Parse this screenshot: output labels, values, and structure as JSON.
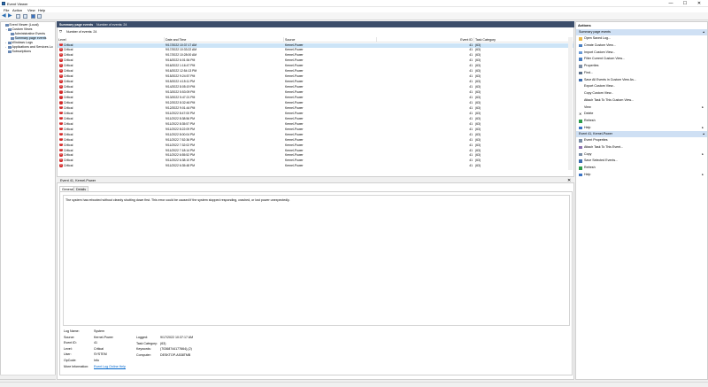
{
  "window": {
    "title": "Event Viewer"
  },
  "window_controls": {
    "minimize": "—",
    "maximize": "☐",
    "close": "✕"
  },
  "menu": [
    "File",
    "Action",
    "View",
    "Help"
  ],
  "tree": [
    {
      "label": "Event Viewer (Local)",
      "level": 0,
      "toggle": ""
    },
    {
      "label": "Custom Views",
      "level": 1,
      "toggle": "⌄"
    },
    {
      "label": "Administrative Events",
      "level": 2,
      "toggle": ""
    },
    {
      "label": "Summary page events",
      "level": 2,
      "toggle": "",
      "selected": true
    },
    {
      "label": "Windows Logs",
      "level": 1,
      "toggle": "›"
    },
    {
      "label": "Applications and Services Lo",
      "level": 1,
      "toggle": "›"
    },
    {
      "label": "Subscriptions",
      "level": 1,
      "toggle": ""
    }
  ],
  "center": {
    "title": "Summary page events",
    "count_label": "Number of events: 24",
    "filter_count": "Number of events: 24"
  },
  "grid": {
    "columns": [
      "Level",
      "Date and Time",
      "Source",
      "Event ID",
      "Task Category"
    ],
    "rows": [
      [
        "Critical",
        "9/17/2022 10:37:17 AM",
        "Kernel-Power",
        "41",
        "(63)"
      ],
      [
        "Critical",
        "9/17/2022 10:33:22 AM",
        "Kernel-Power",
        "41",
        "(63)"
      ],
      [
        "Critical",
        "9/17/2022 10:28:00 AM",
        "Kernel-Power",
        "41",
        "(63)"
      ],
      [
        "Critical",
        "9/16/2022 6:01:54 PM",
        "Kernel-Power",
        "41",
        "(63)"
      ],
      [
        "Critical",
        "9/16/2022 1:16:47 PM",
        "Kernel-Power",
        "41",
        "(63)"
      ],
      [
        "Critical",
        "9/16/2022 12:54:13 PM",
        "Kernel-Power",
        "41",
        "(63)"
      ],
      [
        "Critical",
        "9/15/2022 9:24:57 PM",
        "Kernel-Power",
        "41",
        "(63)"
      ],
      [
        "Critical",
        "9/15/2022 4:15:11 PM",
        "Kernel-Power",
        "41",
        "(63)"
      ],
      [
        "Critical",
        "9/14/2022 8:05:19 PM",
        "Kernel-Power",
        "41",
        "(63)"
      ],
      [
        "Critical",
        "9/13/2022 5:53:09 PM",
        "Kernel-Power",
        "41",
        "(63)"
      ],
      [
        "Critical",
        "9/13/2022 5:47:21 PM",
        "Kernel-Power",
        "41",
        "(63)"
      ],
      [
        "Critical",
        "9/12/2022 8:32:46 PM",
        "Kernel-Power",
        "41",
        "(63)"
      ],
      [
        "Critical",
        "9/12/2022 9:01:44 PM",
        "Kernel-Power",
        "41",
        "(63)"
      ],
      [
        "Critical",
        "9/11/2022 8:47:00 PM",
        "Kernel-Power",
        "41",
        "(63)"
      ],
      [
        "Critical",
        "9/11/2022 8:38:56 PM",
        "Kernel-Power",
        "41",
        "(63)"
      ],
      [
        "Critical",
        "9/11/2022 8:35:57 PM",
        "Kernel-Power",
        "41",
        "(63)"
      ],
      [
        "Critical",
        "9/11/2022 8:22:09 PM",
        "Kernel-Power",
        "41",
        "(63)"
      ],
      [
        "Critical",
        "9/11/2022 8:00:04 PM",
        "Kernel-Power",
        "41",
        "(63)"
      ],
      [
        "Critical",
        "9/11/2022 7:52:36 PM",
        "Kernel-Power",
        "41",
        "(63)"
      ],
      [
        "Critical",
        "9/11/2022 7:32:02 PM",
        "Kernel-Power",
        "41",
        "(63)"
      ],
      [
        "Critical",
        "9/11/2022 7:18:14 PM",
        "Kernel-Power",
        "41",
        "(63)"
      ],
      [
        "Critical",
        "9/11/2022 6:55:52 PM",
        "Kernel-Power",
        "41",
        "(63)"
      ],
      [
        "Critical",
        "9/11/2022 6:38:10 PM",
        "Kernel-Power",
        "41",
        "(63)"
      ],
      [
        "Critical",
        "9/11/2022 6:35:48 PM",
        "Kernel-Power",
        "41",
        "(63)"
      ]
    ]
  },
  "detail": {
    "title": "Event 41, Kernel-Power",
    "tabs": [
      "General",
      "Details"
    ],
    "description": "The system has rebooted without cleanly shutting down first. This error could be caused if the system stopped responding, crashed, or lost power unexpectedly.",
    "props_left": [
      [
        "Log Name:",
        "System"
      ],
      [
        "Source:",
        "Kernel-Power"
      ],
      [
        "Event ID:",
        "41"
      ],
      [
        "Level:",
        "Critical"
      ],
      [
        "User:",
        "SYSTEM"
      ],
      [
        "OpCode:",
        "Info"
      ],
      [
        "More Information:",
        "Event Log Online Help"
      ]
    ],
    "props_right": [
      [
        "Logged:",
        "9/17/2022 10:37:17 AM"
      ],
      [
        "Task Category:",
        "(63)"
      ],
      [
        "Keywords:",
        "(70368744177664),(2)"
      ],
      [
        "Computer:",
        "DESKTOP-A538TMB"
      ]
    ]
  },
  "actions": {
    "title": "Actions",
    "section1": "Summary page events",
    "items1": [
      {
        "label": "Open Saved Log...",
        "icon": "folder-icon",
        "sub": ""
      },
      {
        "label": "Create Custom View...",
        "icon": "filter-icon",
        "sub": ""
      },
      {
        "label": "Import Custom View...",
        "icon": "import-icon",
        "sub": ""
      },
      {
        "label": "Filter Current Custom View...",
        "icon": "filter-icon",
        "sub": ""
      },
      {
        "label": "Properties",
        "icon": "properties-icon",
        "sub": ""
      },
      {
        "label": "Find...",
        "icon": "find-icon",
        "sub": ""
      },
      {
        "label": "Save All Events in Custom View As...",
        "icon": "save-icon",
        "sub": ""
      },
      {
        "label": "Export Custom View...",
        "icon": "blank-icon",
        "sub": ""
      },
      {
        "label": "Copy Custom View...",
        "icon": "blank-icon",
        "sub": ""
      },
      {
        "label": "Attach Task To This Custom View...",
        "icon": "blank-icon",
        "sub": ""
      },
      {
        "label": "View",
        "icon": "blank-icon",
        "sub": "▸"
      },
      {
        "label": "Delete",
        "icon": "delete-icon",
        "sub": ""
      },
      {
        "label": "Refresh",
        "icon": "refresh-icon",
        "sub": ""
      },
      {
        "label": "Help",
        "icon": "help-icon",
        "sub": "▸"
      }
    ],
    "section2": "Event 41, Kernel-Power",
    "items2": [
      {
        "label": "Event Properties",
        "icon": "properties-icon",
        "sub": ""
      },
      {
        "label": "Attach Task To This Event...",
        "icon": "task-icon",
        "sub": ""
      },
      {
        "label": "Copy",
        "icon": "copy-icon",
        "sub": "▸"
      },
      {
        "label": "Save Selected Events...",
        "icon": "save-icon",
        "sub": ""
      },
      {
        "label": "Refresh",
        "icon": "refresh-icon",
        "sub": ""
      },
      {
        "label": "Help",
        "icon": "help-icon",
        "sub": "▸"
      }
    ]
  },
  "colors": {
    "critical": "#d42a2a",
    "header_bg": "#3c4e6b",
    "selection": "#cce4f7",
    "section_bg": "#cfe0f4"
  }
}
